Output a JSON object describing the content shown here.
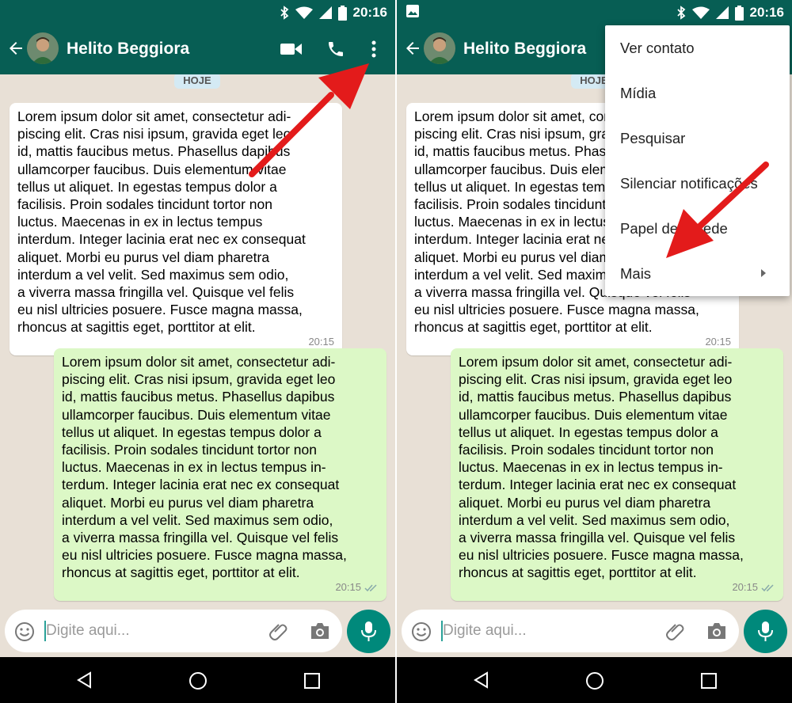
{
  "status": {
    "time": "20:16"
  },
  "header": {
    "contact_name": "Helito Beggiora"
  },
  "chat": {
    "date_label": "HOJE",
    "incoming": {
      "lines": [
        "Lorem ipsum dolor sit amet, consectetur adi-",
        "piscing elit. Cras nisi ipsum, gravida eget leo",
        "id, mattis faucibus metus. Phasellus dapibus",
        "ullamcorper faucibus. Duis elementum vitae",
        "tellus ut aliquet. In egestas tempus dolor a",
        "facilisis. Proin sodales tincidunt tortor non",
        "luctus. Maecenas in ex in lectus tempus",
        "interdum. Integer lacinia erat nec ex consequat",
        "aliquet. Morbi eu purus vel diam pharetra",
        "interdum a vel velit. Sed maximus sem odio,",
        "a viverra massa fringilla vel. Quisque vel felis",
        "eu nisl ultricies posuere. Fusce magna massa,",
        "rhoncus at sagittis eget, porttitor at elit."
      ],
      "time": "20:15"
    },
    "outgoing": {
      "lines": [
        "Lorem ipsum dolor sit amet, consectetur adi-",
        "piscing elit. Cras nisi ipsum, gravida eget leo",
        "id, mattis faucibus metus. Phasellus dapibus",
        "ullamcorper faucibus. Duis elementum vitae",
        "tellus ut aliquet. In egestas tempus dolor a",
        "facilisis. Proin sodales tincidunt tortor non",
        "luctus. Maecenas in ex in lectus tempus in-",
        "terdum. Integer lacinia erat nec ex consequat",
        "aliquet. Morbi eu purus vel diam pharetra",
        "interdum a vel velit. Sed maximus sem odio,",
        "a viverra massa fringilla vel. Quisque vel felis",
        "eu nisl ultricies posuere. Fusce magna massa,",
        "rhoncus at sagittis eget, porttitor at elit."
      ],
      "time": "20:15",
      "status_icon": "double-check-icon"
    }
  },
  "composer": {
    "placeholder": "Digite aqui..."
  },
  "menu": {
    "items": [
      "Ver contato",
      "Mídia",
      "Pesquisar",
      "Silenciar notificações",
      "Papel de parede",
      "Mais"
    ]
  },
  "colors": {
    "appbar": "#075e54",
    "outgoing_bubble": "#dcf8c6",
    "incoming_bubble": "#ffffff",
    "mic_button": "#00897b",
    "annotation_arrow": "#e31b1b",
    "chat_background": "#e8e0d6"
  },
  "icons": [
    "back-arrow-icon",
    "video-call-icon",
    "phone-icon",
    "more-vert-icon",
    "emoji-icon",
    "attach-icon",
    "camera-icon",
    "mic-icon",
    "nav-back-icon",
    "nav-home-icon",
    "nav-recents-icon",
    "bluetooth-icon",
    "wifi-icon",
    "signal-icon",
    "battery-icon",
    "image-notification-icon"
  ]
}
